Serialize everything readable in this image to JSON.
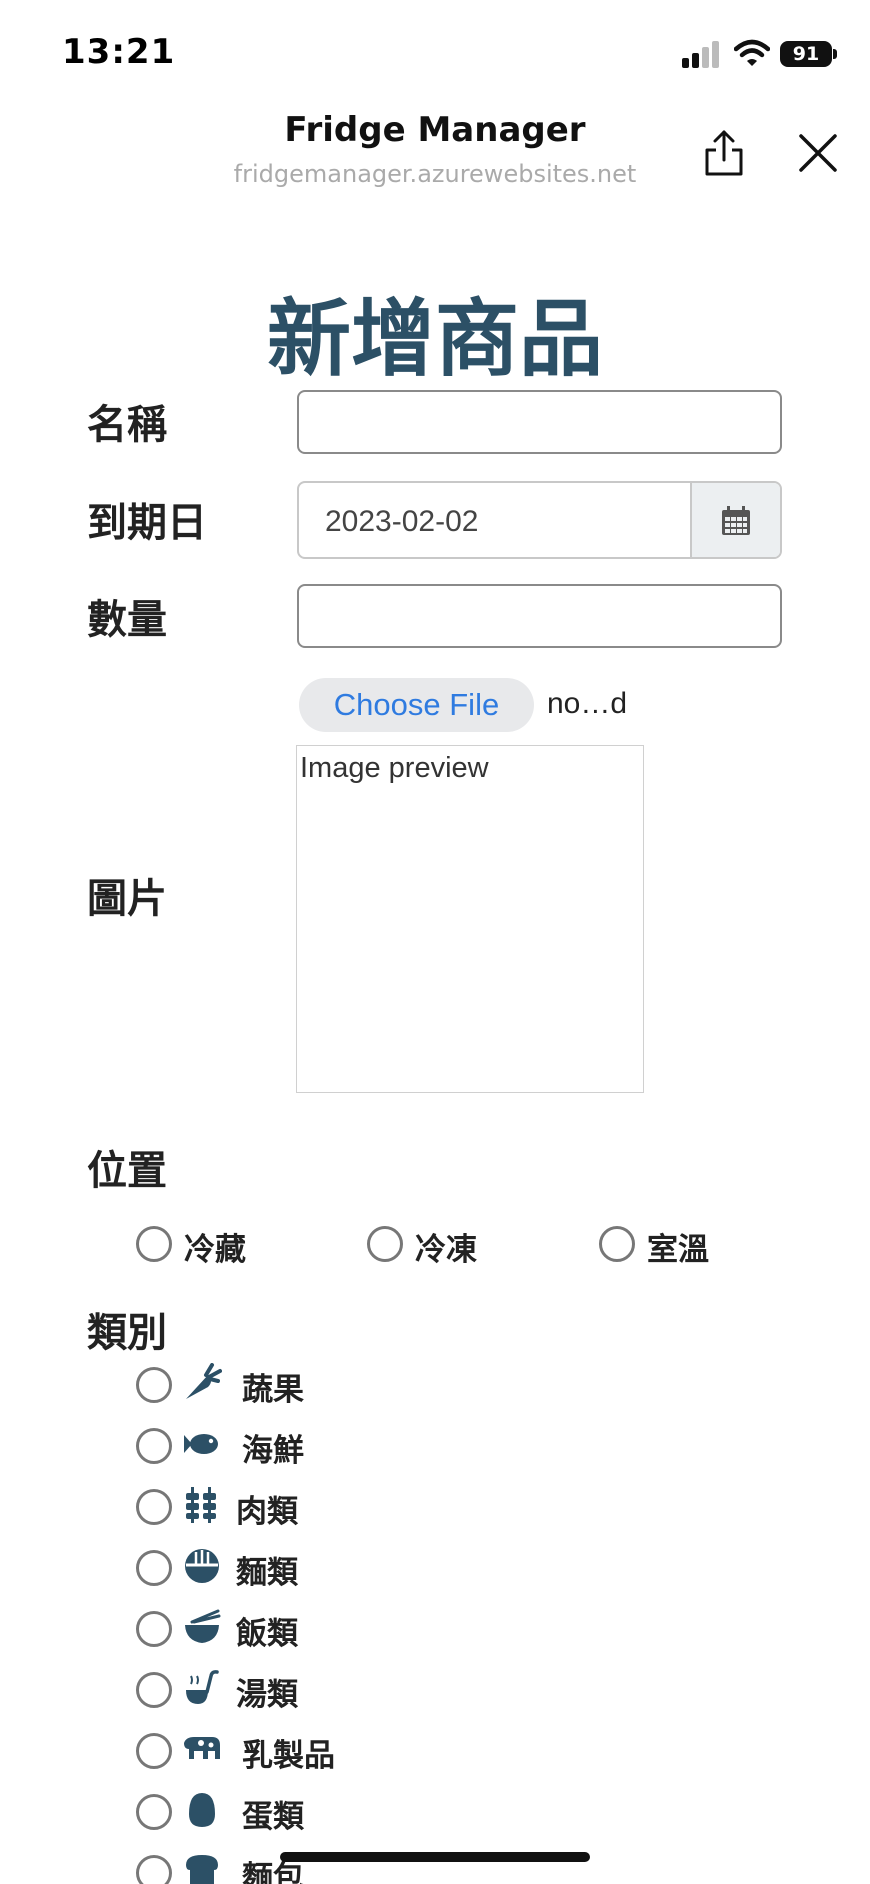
{
  "status_bar": {
    "time": "13:21",
    "battery": "91"
  },
  "browser": {
    "title": "Fridge Manager",
    "url": "fridgemanager.azurewebsites.net"
  },
  "form": {
    "title": "新增商品",
    "name_label": "名稱",
    "name_value": "",
    "expiry_label": "到期日",
    "expiry_value": "2023-02-02",
    "quantity_label": "數量",
    "quantity_value": "",
    "image_label": "圖片",
    "file_button": "Choose File",
    "file_name": "no…d",
    "preview_text": "Image preview"
  },
  "location": {
    "label": "位置",
    "options": [
      "冷藏",
      "冷凍",
      "室溫"
    ]
  },
  "category": {
    "label": "類別",
    "options": [
      {
        "label": "蔬果",
        "icon": "carrot-icon"
      },
      {
        "label": "海鮮",
        "icon": "fish-icon"
      },
      {
        "label": "肉類",
        "icon": "skewer-icon"
      },
      {
        "label": "麵類",
        "icon": "noodle-bowl-icon"
      },
      {
        "label": "飯類",
        "icon": "rice-bowl-icon"
      },
      {
        "label": "湯類",
        "icon": "ladle-icon"
      },
      {
        "label": "乳製品",
        "icon": "cow-icon"
      },
      {
        "label": "蛋類",
        "icon": "egg-icon"
      },
      {
        "label": "麵包",
        "icon": "bread-icon"
      }
    ]
  },
  "colors": {
    "title": "#2c5066",
    "link": "#2f7be0",
    "icon": "#2c5066"
  }
}
